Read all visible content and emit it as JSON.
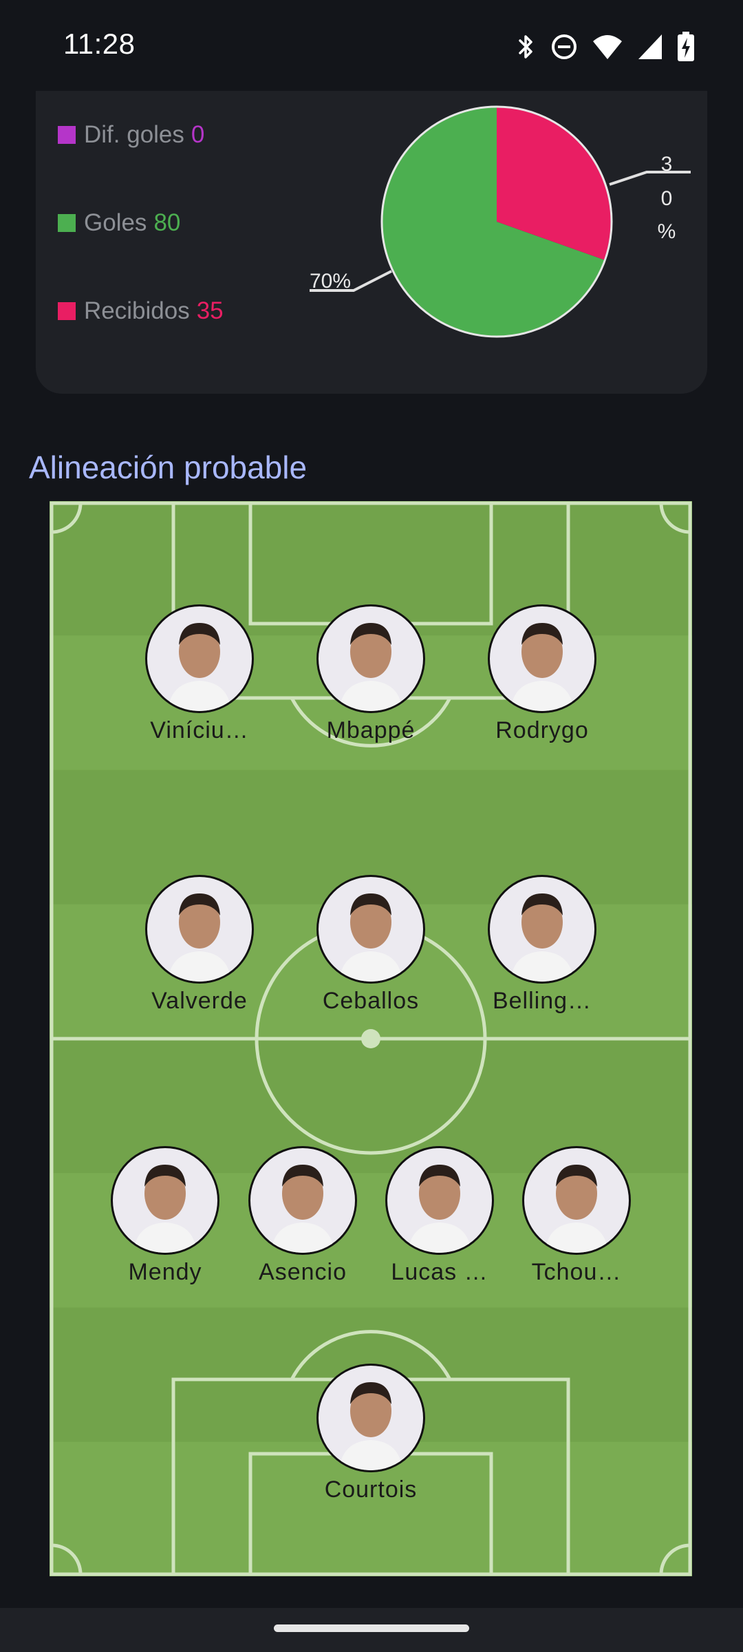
{
  "status_bar": {
    "time": "11:28"
  },
  "stats": {
    "legend": [
      {
        "label": "Dif. goles",
        "value": "0",
        "color": "#b535c9"
      },
      {
        "label": "Goles",
        "value": "80",
        "color": "#4caf50"
      },
      {
        "label": "Recibidos",
        "value": "35",
        "color": "#e91e63"
      }
    ],
    "pie_labels": {
      "goles": "70%",
      "recibidos": "30%",
      "recibidos_chars": [
        "3",
        "0",
        "%"
      ]
    }
  },
  "chart_data": {
    "type": "pie",
    "labels": [
      "Goles",
      "Recibidos",
      "Dif. goles"
    ],
    "values": [
      80,
      35,
      0
    ],
    "percent_labels": [
      "70%",
      "30%"
    ],
    "colors": [
      "#4caf50",
      "#e91e63",
      "#b535c9"
    ]
  },
  "lineup": {
    "title": "Alineación probable",
    "players": [
      {
        "name": "Viníciu…"
      },
      {
        "name": "Mbappé"
      },
      {
        "name": "Rodrygo"
      },
      {
        "name": "Valverde"
      },
      {
        "name": "Ceballos"
      },
      {
        "name": "Belling…"
      },
      {
        "name": "Mendy"
      },
      {
        "name": "Asencio"
      },
      {
        "name": "Lucas …"
      },
      {
        "name": "Tchou…"
      },
      {
        "name": "Courtois"
      }
    ]
  }
}
